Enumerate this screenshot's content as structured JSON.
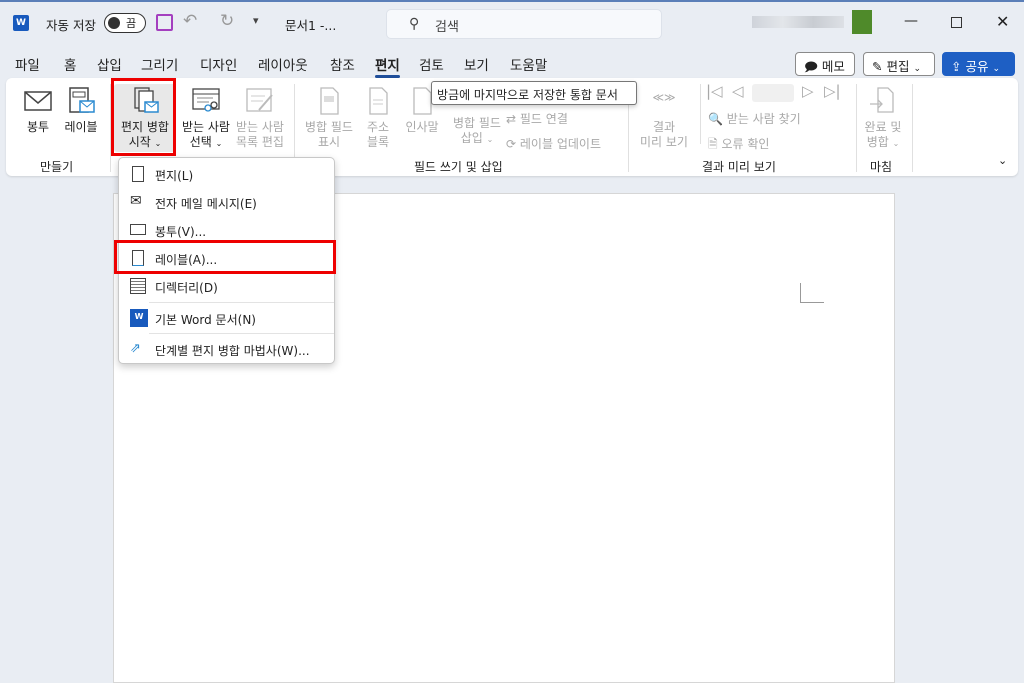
{
  "titlebar": {
    "autosave_label": "자동 저장",
    "autosave_state": "끔",
    "doc_title": "문서1 -...",
    "search_placeholder": "검색"
  },
  "tabs": [
    "파일",
    "홈",
    "삽입",
    "그리기",
    "디자인",
    "레이아웃",
    "참조",
    "편지",
    "검토",
    "보기",
    "도움말"
  ],
  "active_tab": "편지",
  "right_buttons": {
    "memo": "메모",
    "edit": "편집",
    "share": "공유"
  },
  "ribbon": {
    "groups": {
      "create": "만들기",
      "fields": "필드 쓰기 및 삽입",
      "preview": "결과 미리 보기",
      "finish": "마침"
    },
    "envelope": "봉투",
    "label": "레이블",
    "start_merge": [
      "편지 병합",
      "시작"
    ],
    "select_recipients": [
      "받는 사람",
      "선택"
    ],
    "edit_list": [
      "받는 사람",
      "목록 편집"
    ],
    "highlight_fields": [
      "병합 필드",
      "표시"
    ],
    "address_block": [
      "주소",
      "블록"
    ],
    "greeting": "인사말",
    "insert_field": [
      "병합 필드",
      "삽입"
    ],
    "match_fields": "필드 연결",
    "update_labels": "레이블 업데이트",
    "preview_results": [
      "결과",
      "미리 보기"
    ],
    "find_recipient": "받는 사람 찾기",
    "check_errors": "오류 확인",
    "finish_merge": [
      "완료 및",
      "병합"
    ]
  },
  "tooltip": "방금에 마지막으로 저장한 통합 문서",
  "menu": [
    "편지(L)",
    "전자 메일 메시지(E)",
    "봉투(V)...",
    "레이블(A)...",
    "디렉터리(D)",
    "기본 Word 문서(N)",
    "단계별 편지 병합 마법사(W)..."
  ],
  "colors": {
    "accent": "#1e5fc4",
    "highlight": "#e00000",
    "word": "#185abd"
  }
}
